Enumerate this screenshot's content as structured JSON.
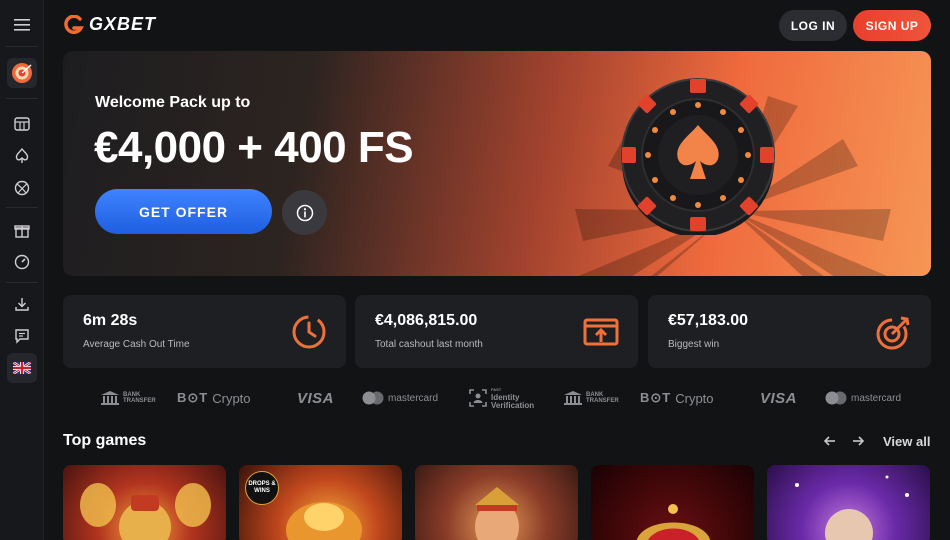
{
  "header": {
    "logo_text": "GXBET",
    "login_label": "LOG IN",
    "signup_label": "SIGN UP"
  },
  "sidebar": {
    "items": [
      {
        "icon": "menu-icon"
      },
      {
        "icon": "target-icon"
      },
      {
        "icon": "slot-machine-icon"
      },
      {
        "icon": "spade-icon"
      },
      {
        "icon": "sports-ball-icon"
      },
      {
        "icon": "gift-icon"
      },
      {
        "icon": "speedometer-icon"
      },
      {
        "icon": "download-icon"
      },
      {
        "icon": "chat-icon"
      },
      {
        "icon": "uk-flag-icon"
      }
    ]
  },
  "hero": {
    "subtitle": "Welcome Pack up to",
    "title": "€4,000 + 400 FS",
    "cta_label": "GET OFFER",
    "info_icon": "info-icon"
  },
  "stats": [
    {
      "value": "6m 28s",
      "label": "Average Cash Out Time",
      "icon": "clock-icon"
    },
    {
      "value": "€4,086,815.00",
      "label": "Total cashout last month",
      "icon": "cashout-icon"
    },
    {
      "value": "€57,183.00",
      "label": "Biggest win",
      "icon": "target-arrow-icon"
    }
  ],
  "payments": {
    "bank_transfer": [
      "BANK",
      "TRANSFER"
    ],
    "crypto": "Crypto",
    "crypto_logo": "B⊙T",
    "visa": "VISA",
    "mastercard": "mastercard",
    "identity": [
      "FAST",
      "Identity",
      "Verification"
    ]
  },
  "top_games": {
    "title": "Top games",
    "view_all": "View all",
    "prev_icon": "arrow-left-icon",
    "next_icon": "arrow-right-icon",
    "badge_text": "DROPS & WINS"
  },
  "colors": {
    "accent_orange": "#f0543a",
    "cta_blue": "#2a6ef5",
    "card_bg": "#1e1f23",
    "page_bg": "#121315"
  }
}
